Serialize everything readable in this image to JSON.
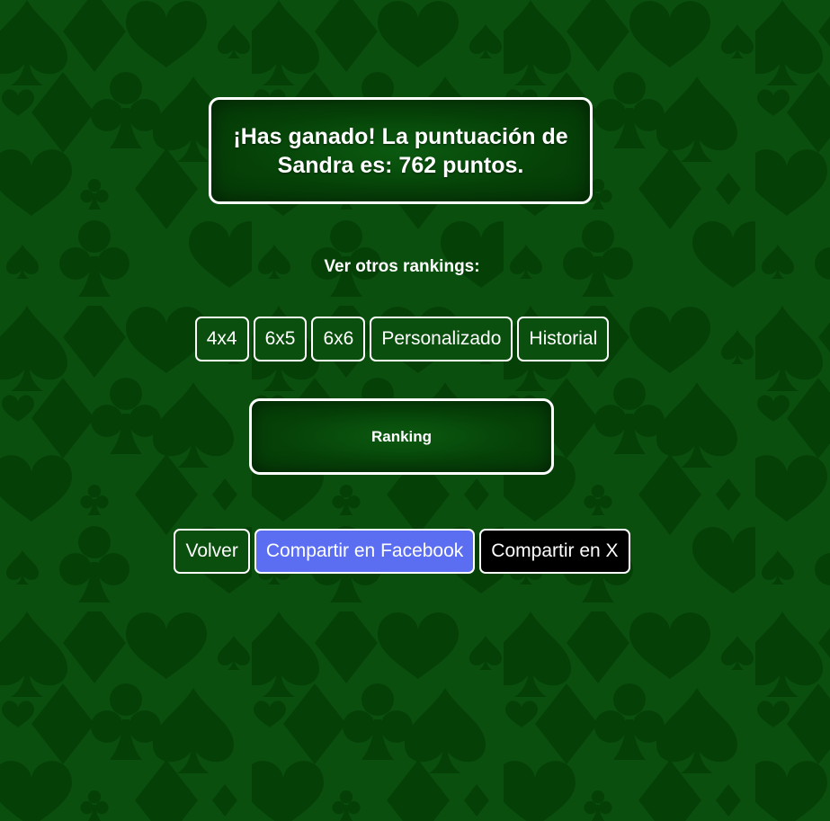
{
  "result": {
    "message": "¡Has ganado! La puntuación de Sandra es: 762 puntos."
  },
  "rankings": {
    "label": "Ver otros rankings:",
    "options": [
      "4x4",
      "6x5",
      "6x6",
      "Personalizado",
      "Historial"
    ]
  },
  "ranking_panel": {
    "title": "Ranking"
  },
  "actions": {
    "back_label": "Volver",
    "facebook_label": "Compartir en Facebook",
    "x_label": "Compartir en X"
  },
  "colors": {
    "background": "#0a4f0e",
    "suit_shape": "#054007",
    "facebook_button": "#5b6ef2",
    "x_button": "#000000",
    "border": "#ffffff"
  },
  "icons": {
    "background_pattern": [
      "spade-icon",
      "heart-icon",
      "diamond-icon",
      "club-icon"
    ]
  }
}
